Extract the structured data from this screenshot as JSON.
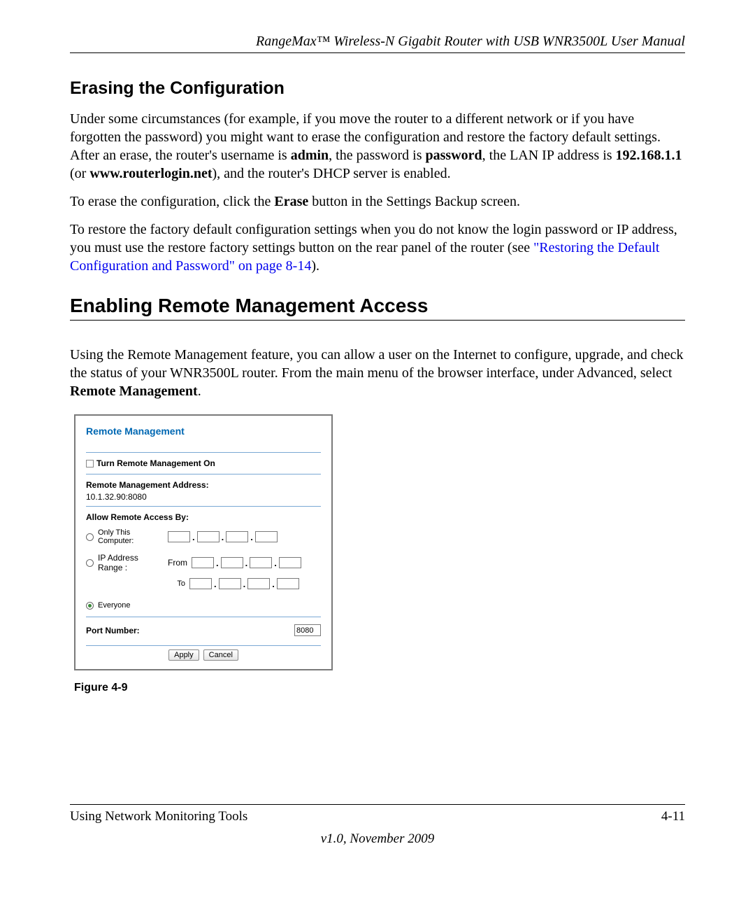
{
  "header": {
    "doc_title": "RangeMax™ Wireless-N Gigabit Router with USB WNR3500L User Manual"
  },
  "sections": {
    "erasing_title": "Erasing the Configuration",
    "erasing_p1_a": "Under some circumstances (for example, if you move the router to a different network or if you have forgotten the password) you might want to erase the configuration and restore the factory default settings. After an erase, the router's username is ",
    "erasing_p1_admin": "admin",
    "erasing_p1_b": ", the password is ",
    "erasing_p1_password": "password",
    "erasing_p1_c": ", the LAN IP address is ",
    "erasing_p1_ip": "192.168.1.1",
    "erasing_p1_d": " (or ",
    "erasing_p1_url": "www.routerlogin.net",
    "erasing_p1_e": "), and the router's DHCP server is enabled.",
    "erasing_p2_a": "To erase the configuration, click the ",
    "erasing_p2_erase": "Erase",
    "erasing_p2_b": " button in the Settings Backup screen.",
    "erasing_p3_a": "To restore the factory default configuration settings when you do not know the login password or IP address, you must use the restore factory settings button on the rear panel of the router (see ",
    "erasing_p3_link": "\"Restoring the Default Configuration and Password\" on page 8-14",
    "erasing_p3_b": ").",
    "enabling_title": "Enabling Remote Management Access",
    "enabling_p1_a": "Using the Remote Management feature, you can allow a user on the Internet to configure, upgrade, and check the status of your WNR3500L router. From the main menu of the browser interface, under Advanced, select ",
    "enabling_p1_rm": "Remote Management",
    "enabling_p1_b": "."
  },
  "screenshot": {
    "title": "Remote Management",
    "turn_on_label": "Turn Remote Management On",
    "address_label": "Remote Management Address:",
    "address_value": "10.1.32.90:8080",
    "allow_label": "Allow Remote Access By:",
    "only_this": "Only This Computer:",
    "ip_range": "IP Address Range :",
    "from_label": "From",
    "to_label": "To",
    "everyone": "Everyone",
    "port_label": "Port Number:",
    "port_value": "8080",
    "apply": "Apply",
    "cancel": "Cancel"
  },
  "figure_caption": "Figure 4-9",
  "footer": {
    "chapter": "Using Network Monitoring Tools",
    "page_num": "4-11",
    "version": "v1.0, November 2009"
  }
}
